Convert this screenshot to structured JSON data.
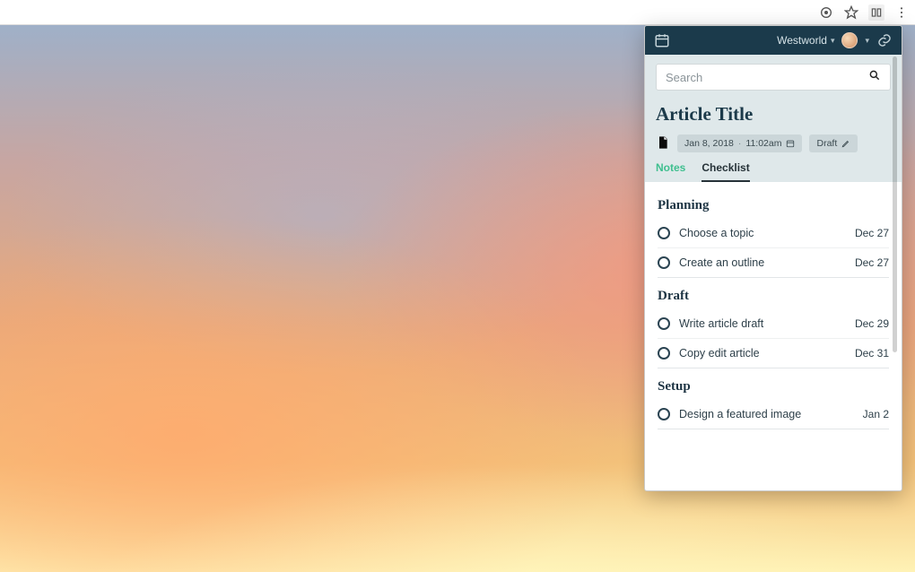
{
  "browser": {
    "icons": [
      "target",
      "star",
      "extension",
      "menu"
    ]
  },
  "topbar": {
    "workspace": "Westworld"
  },
  "search": {
    "placeholder": "Search"
  },
  "article": {
    "title": "Article Title",
    "date": "Jan 8, 2018",
    "time": "11:02am",
    "status": "Draft"
  },
  "tabs": {
    "notes": "Notes",
    "checklist": "Checklist",
    "active": "checklist"
  },
  "sections": [
    {
      "title": "Planning",
      "tasks": [
        {
          "label": "Choose a topic",
          "due": "Dec 27"
        },
        {
          "label": "Create an outline",
          "due": "Dec 27"
        }
      ]
    },
    {
      "title": "Draft",
      "tasks": [
        {
          "label": "Write article draft",
          "due": "Dec 29"
        },
        {
          "label": "Copy edit article",
          "due": "Dec 31"
        }
      ]
    },
    {
      "title": "Setup",
      "tasks": [
        {
          "label": "Design a featured image",
          "due": "Jan 2"
        }
      ]
    }
  ]
}
